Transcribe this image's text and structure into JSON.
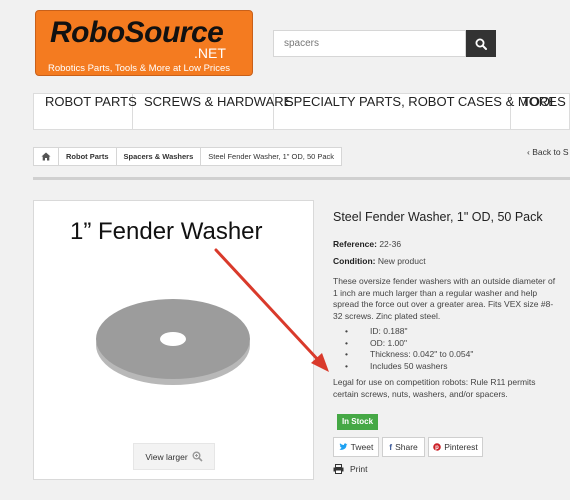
{
  "logo": {
    "brand": "RoboSource",
    "domain": ".NET",
    "tagline": "Robotics Parts, Tools & More at Low Prices"
  },
  "search": {
    "value": "spacers"
  },
  "nav": [
    "Robot Parts",
    "Screws & Hardware",
    "Specialty Parts, Robot Cases & More",
    "Tools"
  ],
  "breadcrumb": {
    "items": [
      "Robot Parts",
      "Spacers & Washers",
      "Steel Fender Washer, 1\" OD, 50 Pack"
    ],
    "back": "Back to S"
  },
  "product": {
    "image_title": "1” Fender Washer",
    "view_larger": "View larger",
    "title": "Steel Fender Washer, 1\" OD, 50 Pack",
    "reference_label": "Reference:",
    "reference": "22-36",
    "condition_label": "Condition:",
    "condition": "New product",
    "description": "These oversize fender washers with an outside diameter of 1 inch are much larger than a regular washer and help spread the force out over a greater area. Fits VEX size #8-32 screws. Zinc plated steel.",
    "specs": [
      "ID: 0.188\"",
      "OD: 1.00\"",
      "Thickness: 0.042\" to 0.054\"",
      "Includes 50 washers"
    ],
    "legal": "Legal for use on competition robots: Rule R11 permits certain screws, nuts, washers, and/or spacers.",
    "stock": "In Stock",
    "share": {
      "tweet": "Tweet",
      "share": "Share",
      "pinterest": "Pinterest"
    },
    "print": "Print"
  },
  "colors": {
    "logo_orange": "#f47b20",
    "arrow_red": "#d93a2b",
    "in_stock_green": "#45a845",
    "twitter": "#1da1f2",
    "facebook": "#3b5998",
    "pinterest": "#cb2027"
  }
}
